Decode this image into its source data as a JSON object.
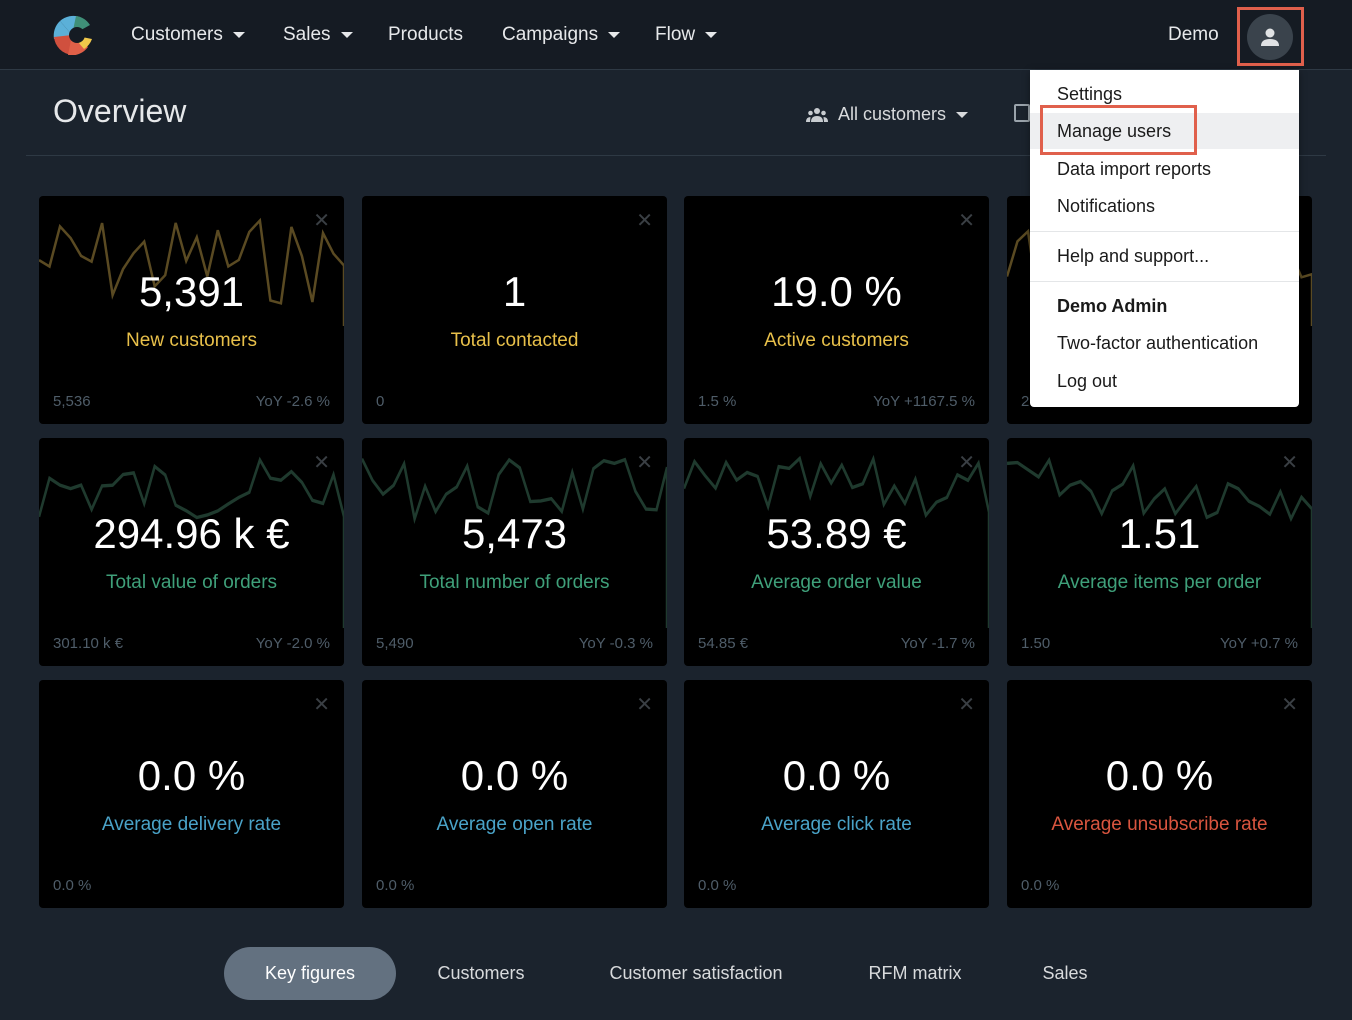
{
  "nav": {
    "items": [
      {
        "label": "Customers",
        "dropdown": true
      },
      {
        "label": "Sales",
        "dropdown": true
      },
      {
        "label": "Products",
        "dropdown": false
      },
      {
        "label": "Campaigns",
        "dropdown": true
      },
      {
        "label": "Flow",
        "dropdown": true
      }
    ],
    "user": "Demo",
    "avatar_icon": "user-icon"
  },
  "header": {
    "title": "Overview",
    "filter": "All customers"
  },
  "menu": {
    "items": [
      "Settings",
      "Manage users",
      "Data import reports",
      "Notifications",
      "Help and support...",
      "Demo Admin",
      "Two-factor authentication",
      "Log out"
    ],
    "highlighted": "Manage users"
  },
  "colors": {
    "gold": "#e8c04a",
    "green": "#3fa07a",
    "blue": "#4aa3c8",
    "red": "#d9553f",
    "highlight": "#e0604c"
  },
  "cards": [
    {
      "value": "5,391",
      "label": "New customers",
      "left": "5,536",
      "right": "YoY -2.6 %",
      "color": "#e8c04a",
      "spark": "#5a4a22"
    },
    {
      "value": "1",
      "label": "Total contacted",
      "left": "0",
      "right": "",
      "color": "#e8c04a",
      "spark": ""
    },
    {
      "value": "19.0 %",
      "label": "Active customers",
      "left": "1.5 %",
      "right": "YoY +1167.5 %",
      "color": "#e8c04a",
      "spark": ""
    },
    {
      "value": "",
      "label": "",
      "left": "2",
      "right": "",
      "color": "#e8c04a",
      "spark": "#5a4a22"
    },
    {
      "value": "294.96 k €",
      "label": "Total value of orders",
      "left": "301.10 k €",
      "right": "YoY -2.0 %",
      "color": "#3fa07a",
      "spark": "#1f3a2e"
    },
    {
      "value": "5,473",
      "label": "Total number of orders",
      "left": "5,490",
      "right": "YoY -0.3 %",
      "color": "#3fa07a",
      "spark": "#1f3a2e"
    },
    {
      "value": "53.89 €",
      "label": "Average order value",
      "left": "54.85 €",
      "right": "YoY -1.7 %",
      "color": "#3fa07a",
      "spark": "#1f3a2e"
    },
    {
      "value": "1.51",
      "label": "Average items per order",
      "left": "1.50",
      "right": "YoY +0.7 %",
      "color": "#3fa07a",
      "spark": "#1f3a2e"
    },
    {
      "value": "0.0 %",
      "label": "Average delivery rate",
      "left": "0.0 %",
      "right": "",
      "color": "#4aa3c8",
      "spark": ""
    },
    {
      "value": "0.0 %",
      "label": "Average open rate",
      "left": "0.0 %",
      "right": "",
      "color": "#4aa3c8",
      "spark": ""
    },
    {
      "value": "0.0 %",
      "label": "Average click rate",
      "left": "0.0 %",
      "right": "",
      "color": "#4aa3c8",
      "spark": ""
    },
    {
      "value": "0.0 %",
      "label": "Average unsubscribe rate",
      "left": "0.0 %",
      "right": "",
      "color": "#d9553f",
      "spark": ""
    }
  ],
  "tabs": [
    {
      "label": "Key figures",
      "active": true
    },
    {
      "label": "Customers"
    },
    {
      "label": "Customer satisfaction"
    },
    {
      "label": "RFM matrix"
    },
    {
      "label": "Sales"
    }
  ]
}
